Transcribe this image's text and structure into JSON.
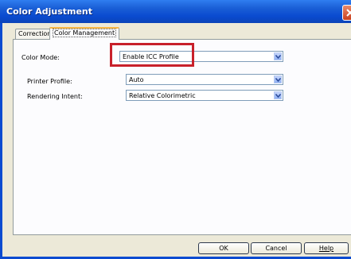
{
  "window": {
    "title": "Color Adjustment"
  },
  "tabs": [
    {
      "label": "Correction",
      "active": false
    },
    {
      "label": "Color Management",
      "active": true
    }
  ],
  "color_management": {
    "color_mode": {
      "label": "Color Mode:",
      "value": "Enable ICC Profile"
    },
    "printer_profile": {
      "label": "Printer Profile:",
      "value": "Auto"
    },
    "rendering_intent": {
      "label": "Rendering Intent:",
      "value": "Relative Colorimetric"
    }
  },
  "buttons": {
    "ok": "OK",
    "cancel": "Cancel",
    "help": "Help"
  },
  "icons": {
    "close": "close-icon",
    "dropdown": "chevron-down-icon"
  },
  "colors": {
    "titlebar": "#0a4bd0",
    "highlight_box": "#c8202a",
    "active_tab_accent": "#f7b745"
  }
}
